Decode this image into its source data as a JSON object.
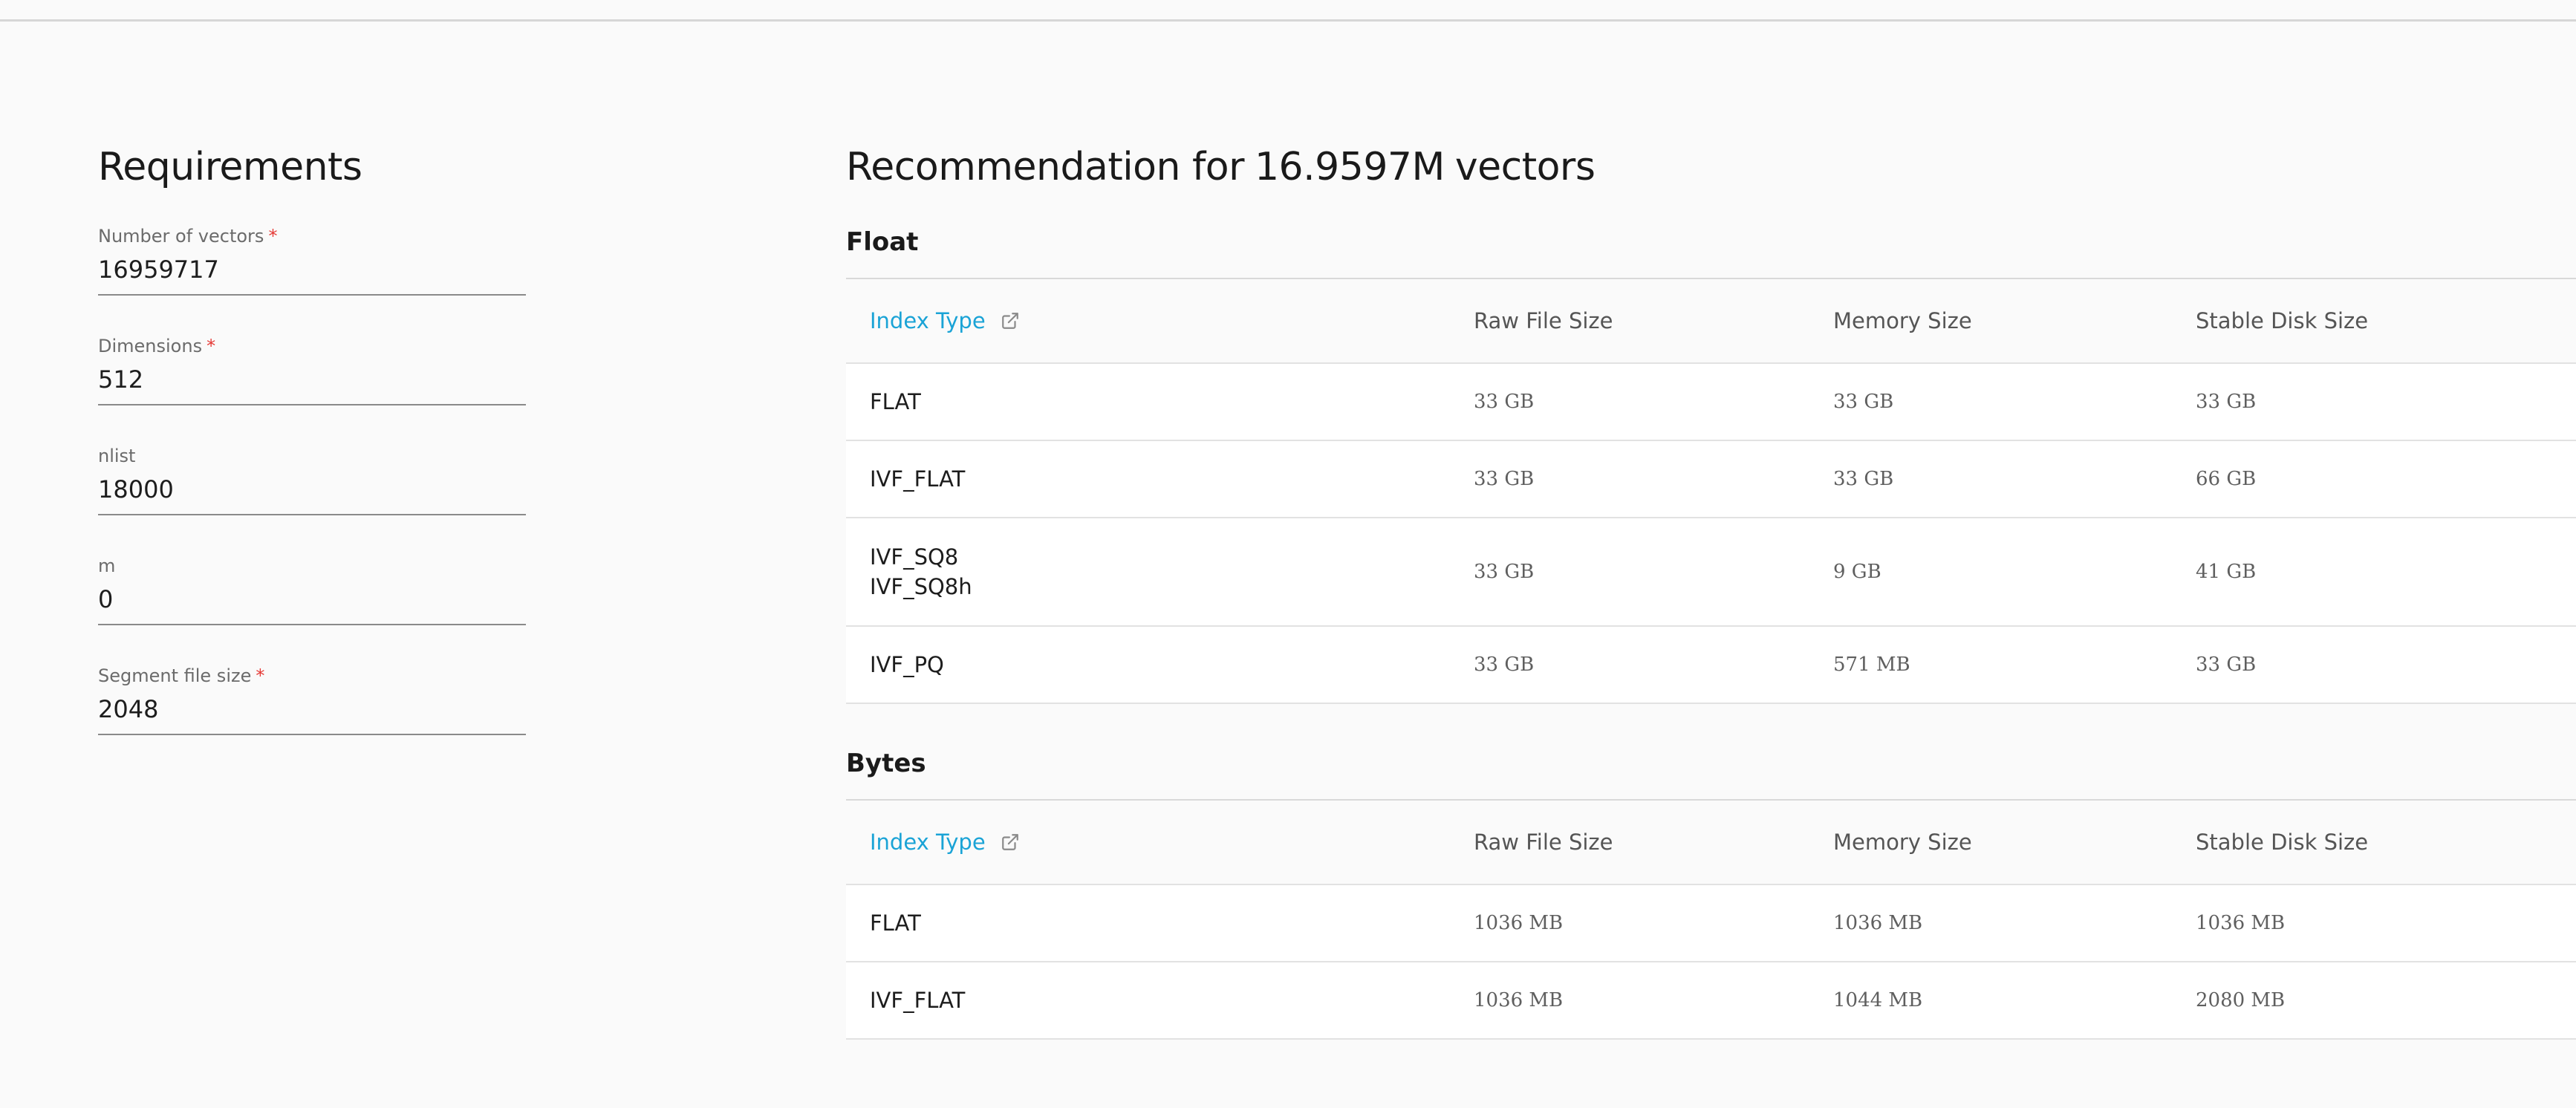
{
  "requirements": {
    "title": "Requirements",
    "fields": [
      {
        "label": "Number of vectors",
        "required": true,
        "value": "16959717"
      },
      {
        "label": "Dimensions",
        "required": true,
        "value": "512"
      },
      {
        "label": "nlist",
        "required": false,
        "value": "18000"
      },
      {
        "label": "m",
        "required": false,
        "value": "0"
      },
      {
        "label": "Segment file size",
        "required": true,
        "value": "2048"
      }
    ],
    "required_marker": "*"
  },
  "recommendation": {
    "title_prefix": "Recommendation for",
    "count": "16.9597M",
    "title_suffix": "vectors",
    "columns": {
      "index_type": "Index Type",
      "raw_file_size": "Raw File Size",
      "memory_size": "Memory Size",
      "stable_disk_size": "Stable Disk Size"
    },
    "float": {
      "title": "Float",
      "rows": [
        {
          "types": [
            "FLAT"
          ],
          "raw": "33 GB",
          "memory": "33 GB",
          "disk": "33 GB"
        },
        {
          "types": [
            "IVF_FLAT"
          ],
          "raw": "33 GB",
          "memory": "33 GB",
          "disk": "66 GB"
        },
        {
          "types": [
            "IVF_SQ8",
            "IVF_SQ8h"
          ],
          "raw": "33 GB",
          "memory": "9 GB",
          "disk": "41 GB"
        },
        {
          "types": [
            "IVF_PQ"
          ],
          "raw": "33 GB",
          "memory": "571 MB",
          "disk": "33 GB"
        }
      ]
    },
    "bytes": {
      "title": "Bytes",
      "rows": [
        {
          "types": [
            "FLAT"
          ],
          "raw": "1036 MB",
          "memory": "1036 MB",
          "disk": "1036 MB"
        },
        {
          "types": [
            "IVF_FLAT"
          ],
          "raw": "1036 MB",
          "memory": "1044 MB",
          "disk": "2080 MB"
        }
      ]
    }
  },
  "icons": {
    "index_type_link": "external-link-icon"
  },
  "colors": {
    "accent": "#1aa3d6",
    "required": "#e53935"
  }
}
